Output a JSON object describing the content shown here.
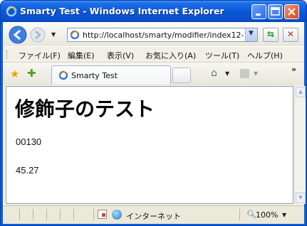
{
  "window": {
    "title": "Smarty Test - Windows Internet Explorer"
  },
  "address_bar": {
    "url": "http://localhost/smarty/modifier/index12-1.p"
  },
  "menu": {
    "items": [
      "ファイル(F)",
      "編集(E)",
      "表示(V)",
      "お気に入り(A)",
      "ツール(T)",
      "ヘルプ(H)"
    ]
  },
  "favorites_bar": {
    "overflow": "»"
  },
  "tab": {
    "label": "Smarty Test"
  },
  "page": {
    "heading": "修飾子のテスト",
    "value1": "00130",
    "value2": "45.27"
  },
  "status_bar": {
    "zone": "インターネット",
    "zoom": "100%"
  },
  "colors": {
    "titlebar": "#0a58d6",
    "close_button": "#d84a1c"
  }
}
